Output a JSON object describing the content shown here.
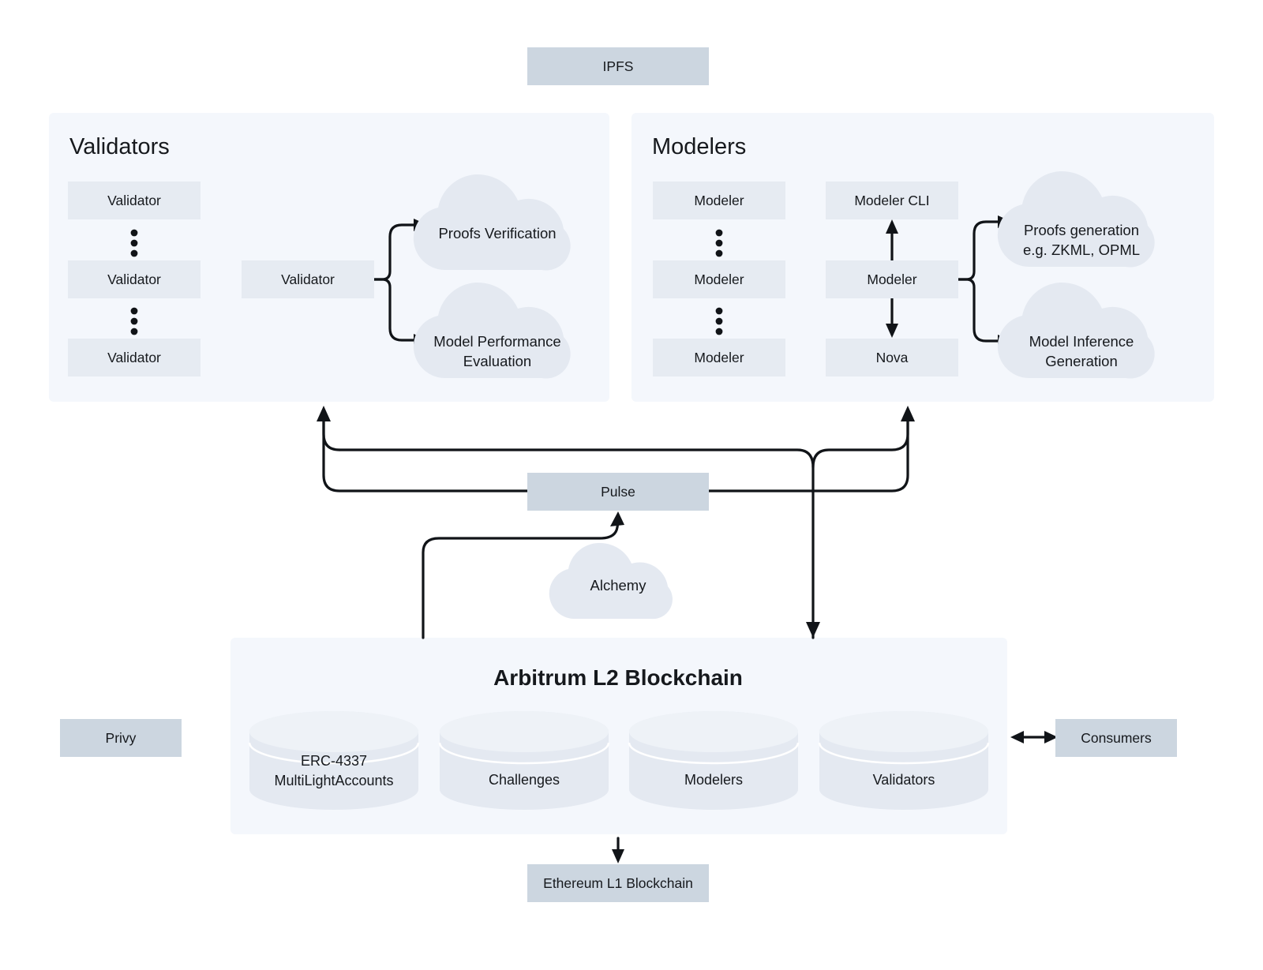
{
  "colors": {
    "page_background": "#ffffff",
    "panel_background": "#f4f7fc",
    "node_fill": "#e6ebf2",
    "accent_fill": "#ccd6e0",
    "cloud_fill": "#e4e9f1",
    "cylinder_fill": "#e4e9f1",
    "connector_stroke": "#111418",
    "text": "#16191d"
  },
  "top": {
    "ipfs_label": "IPFS"
  },
  "validators_panel": {
    "title": "Validators",
    "stack": [
      {
        "label": "Validator"
      },
      {
        "label": "Validator"
      },
      {
        "label": "Validator"
      }
    ],
    "ellipsis_count": 2,
    "focus_node": {
      "label": "Validator"
    },
    "clouds": [
      {
        "lines": [
          "Proofs Verification"
        ]
      },
      {
        "lines": [
          "Model Performance",
          "Evaluation"
        ]
      }
    ]
  },
  "modelers_panel": {
    "title": "Modelers",
    "stack": [
      {
        "label": "Modeler"
      },
      {
        "label": "Modeler"
      },
      {
        "label": "Modeler"
      }
    ],
    "ellipsis_count": 2,
    "pipeline": {
      "top": {
        "label": "Modeler CLI"
      },
      "middle": {
        "label": "Modeler"
      },
      "bottom": {
        "label": "Nova"
      }
    },
    "clouds": [
      {
        "lines": [
          "Proofs generation",
          "e.g. ZKML, OPML"
        ]
      },
      {
        "lines": [
          "Model Inference",
          "Generation"
        ]
      }
    ]
  },
  "middle": {
    "pulse_label": "Pulse",
    "alchemy_label": "Alchemy"
  },
  "blockchain_panel": {
    "title": "Arbitrum L2 Blockchain",
    "stores": [
      {
        "lines": [
          "ERC-4337",
          "MultiLightAccounts"
        ]
      },
      {
        "lines": [
          "Challenges"
        ]
      },
      {
        "lines": [
          "Modelers"
        ]
      },
      {
        "lines": [
          "Validators"
        ]
      }
    ]
  },
  "side": {
    "privy_label": "Privy",
    "consumers_label": "Consumers"
  },
  "bottom": {
    "ethereum_label": "Ethereum L1 Blockchain"
  }
}
